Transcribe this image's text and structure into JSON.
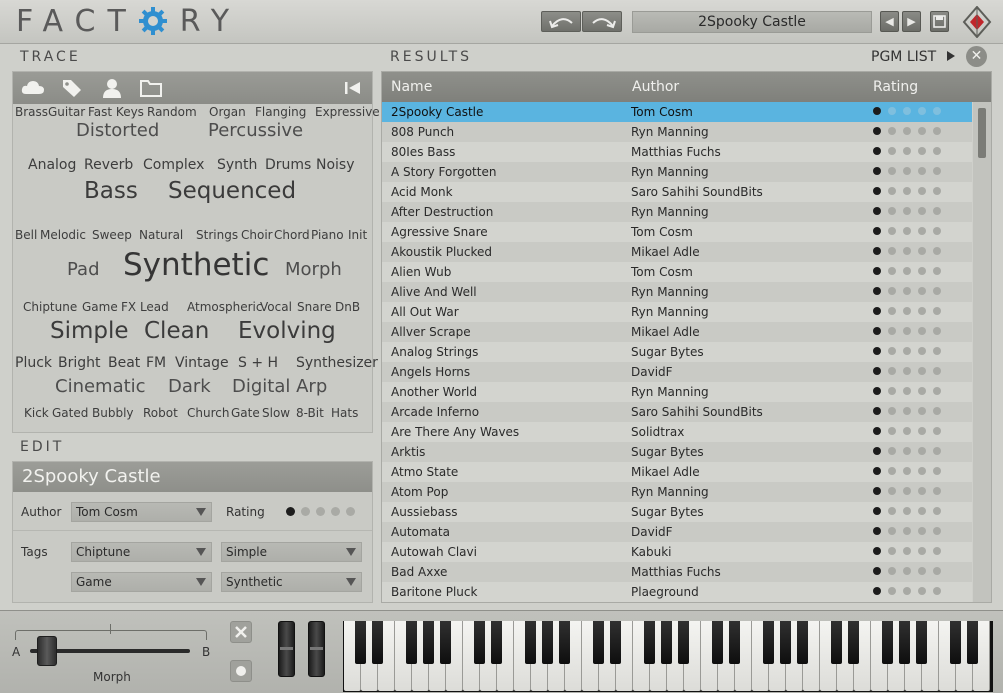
{
  "app": {
    "logo_text_left": "FACT",
    "logo_text_right": "RY",
    "preset_name": "2Spooky Castle",
    "prev_symbol": "◀",
    "next_symbol": "▶"
  },
  "sections": {
    "trace": "TRACE",
    "results": "RESULTS",
    "edit": "EDIT",
    "pgm_list": "PGM LIST"
  },
  "trace": {
    "toolbar_icons": [
      "cloud-icon",
      "tag-icon",
      "user-icon",
      "folder-icon",
      "skip-back-icon"
    ],
    "tags": [
      [
        "Brass",
        "Guitar",
        "Fast Keys",
        "Random",
        "Organ",
        "Flanging",
        "Expressive"
      ],
      [
        "Distorted",
        "Percussive"
      ],
      [
        "Analog",
        "Reverb",
        "Complex",
        "Synth",
        "Drums",
        "Noisy"
      ],
      [
        "Bass",
        "Sequenced"
      ],
      [
        "Bell",
        "Melodic",
        "Sweep",
        "Natural",
        "Strings",
        "Choir",
        "Chord",
        "Piano",
        "Init"
      ],
      [
        "Pad",
        "Synthetic",
        "Morph"
      ],
      [
        "Chiptune",
        "Game",
        "FX Lead",
        "Atmospheric",
        "Vocal",
        "Snare",
        "DnB"
      ],
      [
        "Simple",
        "Clean",
        "Evolving"
      ],
      [
        "Pluck",
        "Bright",
        "Beat",
        "FM",
        "Vintage",
        "S + H",
        "Synthesizer"
      ],
      [
        "Cinematic",
        "Dark",
        "Digital Arp"
      ],
      [
        "Kick",
        "Gated",
        "Bubbly",
        "Robot",
        "Church",
        "Gate",
        "Slow",
        "8-Bit",
        "Hats"
      ]
    ]
  },
  "edit": {
    "name": "2Spooky Castle",
    "author_label": "Author",
    "author_value": "Tom Cosm",
    "rating_label": "Rating",
    "rating": 1,
    "rating_max": 5,
    "tags_label": "Tags",
    "tag1": "Chiptune",
    "tag2": "Simple",
    "tag3": "Game",
    "tag4": "Synthetic"
  },
  "results": {
    "columns": [
      "Name",
      "Author",
      "Rating"
    ],
    "selected_index": 0,
    "rows": [
      [
        "2Spooky Castle",
        "Tom Cosm",
        1
      ],
      [
        "808 Punch",
        "Ryn Manning",
        1
      ],
      [
        "80Ies Bass",
        "Matthias Fuchs",
        1
      ],
      [
        "A Story Forgotten",
        "Ryn Manning",
        1
      ],
      [
        "Acid Monk",
        "Saro Sahihi SoundBits",
        1
      ],
      [
        "After Destruction",
        "Ryn Manning",
        1
      ],
      [
        "Agressive Snare",
        "Tom Cosm",
        1
      ],
      [
        "Akoustik Plucked",
        "Mikael Adle",
        1
      ],
      [
        "Alien Wub",
        "Tom Cosm",
        1
      ],
      [
        "Alive And Well",
        "Ryn Manning",
        1
      ],
      [
        "All Out War",
        "Ryn Manning",
        1
      ],
      [
        "Allver Scrape",
        "Mikael Adle",
        1
      ],
      [
        "Analog Strings",
        "Sugar Bytes",
        1
      ],
      [
        "Angels Horns",
        "DavidF",
        1
      ],
      [
        "Another World",
        "Ryn Manning",
        1
      ],
      [
        "Arcade Inferno",
        "Saro Sahihi SoundBits",
        1
      ],
      [
        "Are There Any Waves",
        "Solidtrax",
        1
      ],
      [
        "Arktis",
        "Sugar Bytes",
        1
      ],
      [
        "Atmo State",
        "Mikael Adle",
        1
      ],
      [
        "Atom Pop",
        "Ryn Manning",
        1
      ],
      [
        "Aussiebass",
        "Sugar Bytes",
        1
      ],
      [
        "Automata",
        "DavidF",
        1
      ],
      [
        "Autowah Clavi",
        "Kabuki",
        1
      ],
      [
        "Bad Axxe",
        "Matthias Fuchs",
        1
      ],
      [
        "Baritone Pluck",
        "Plaeground",
        1
      ]
    ]
  },
  "bottom": {
    "morph_a": "A",
    "morph_b": "B",
    "morph_label": "Morph",
    "morph_value": 0.05
  },
  "colors": {
    "accent": "#5ab4e0",
    "logo_gear": "#2f8fd0",
    "diamond": "#c0262b"
  }
}
